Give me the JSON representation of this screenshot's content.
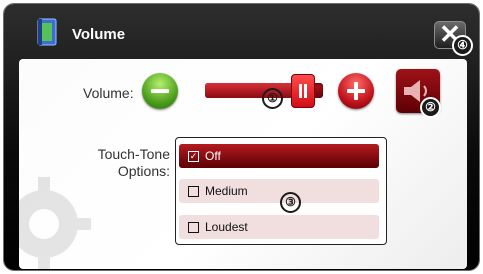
{
  "window": {
    "title": "Volume",
    "close_glyph": "✕",
    "title_icon": "phone-book-icon"
  },
  "volume": {
    "label": "Volume:",
    "decrease_icon": "minus-icon",
    "increase_icon": "plus-icon",
    "mute_icon": "speaker-icon",
    "level": 0.9
  },
  "touch_tone": {
    "label": "Touch-Tone Options:",
    "options": [
      {
        "label": "Off",
        "checked": true
      },
      {
        "label": "Medium",
        "checked": false
      },
      {
        "label": "Loudest",
        "checked": false
      }
    ]
  },
  "markers": [
    "①",
    "②",
    "③",
    "④"
  ],
  "colors": {
    "accent_red": "#c0141b",
    "accent_green": "#4da01d"
  }
}
